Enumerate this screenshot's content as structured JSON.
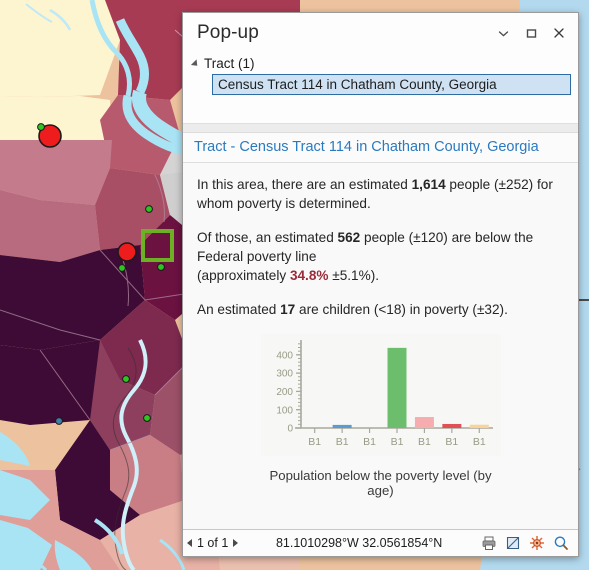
{
  "window": {
    "title": "Pop-up",
    "controls": [
      {
        "name": "collapse-button",
        "glyph": "chevron-down"
      },
      {
        "name": "maximize-button",
        "glyph": "square"
      },
      {
        "name": "close-button",
        "glyph": "x"
      }
    ]
  },
  "tree": {
    "group_label": "Tract (1)",
    "selected_item": "Census Tract 114 in Chatham County, Georgia"
  },
  "section": {
    "header": "Tract - Census Tract 114 in Chatham County, Georgia"
  },
  "paragraphs": [
    {
      "id": "p1",
      "parts": [
        {
          "t": "In this area, there are an estimated ",
          "s": "n"
        },
        {
          "t": "1,614",
          "s": "b"
        },
        {
          "t": " people (±252) for whom poverty is determined.",
          "s": "n"
        }
      ]
    },
    {
      "id": "p2",
      "parts": [
        {
          "t": "Of those, an estimated ",
          "s": "n"
        },
        {
          "t": "562",
          "s": "b"
        },
        {
          "t": " people (±120) are below the Federal poverty line",
          "s": "n"
        },
        {
          "t": "\n(approximately ",
          "s": "n"
        },
        {
          "t": "34.8%",
          "s": "h"
        },
        {
          "t": " ±5.1%).",
          "s": "n"
        }
      ]
    },
    {
      "id": "p3",
      "parts": [
        {
          "t": "An estimated ",
          "s": "n"
        },
        {
          "t": "17",
          "s": "b"
        },
        {
          "t": " are children (<18) in poverty (±32).",
          "s": "n"
        }
      ]
    }
  ],
  "chart_data": {
    "type": "bar",
    "title": "",
    "caption": "Population below the poverty level (by age)",
    "xlabel": "",
    "ylabel": "",
    "categories": [
      "B1",
      "B1",
      "B1",
      "B1",
      "B1",
      "B1",
      "B1"
    ],
    "values": [
      0,
      17,
      0,
      438,
      60,
      22,
      18
    ],
    "colors": [
      "#f5aeb0",
      "#5b9bd5",
      "#f5aeb0",
      "#6cbe6c",
      "#f7adaf",
      "#e05055",
      "#fad396"
    ],
    "ylim": [
      0,
      470
    ],
    "yticks": [
      0,
      100,
      200,
      300,
      400
    ],
    "ytick_labels": [
      "0",
      "100",
      "200",
      "300",
      "400"
    ],
    "grid": false,
    "legend": "none",
    "axis_color": "#a8a89c",
    "tick_label_color": "#9a9a86",
    "plot_background": "#f7f8f6"
  },
  "nav": {
    "prev_label": "prev",
    "page_label": "1 of 1",
    "next_label": "next",
    "coordinates": "81.1010298°W 32.0561854°N",
    "icons": [
      {
        "name": "print-icon",
        "title": "print"
      },
      {
        "name": "select-shape-icon",
        "title": "select"
      },
      {
        "name": "compass-icon",
        "title": "directions"
      },
      {
        "name": "zoom-to-icon",
        "title": "zoom to"
      }
    ]
  },
  "map": {
    "water_color": "#a9e4f5",
    "ocean_color": "#b3d9ef",
    "land_color": "#edb99b",
    "highlight_outline": "#6cb024",
    "marker_color": "#ee1c1c",
    "point_color": "#2fc422"
  }
}
